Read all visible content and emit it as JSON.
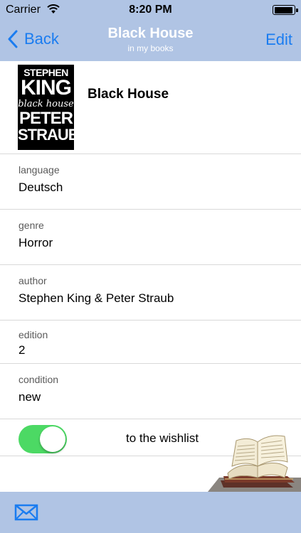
{
  "status_bar": {
    "carrier": "Carrier",
    "time": "8:20 PM",
    "battery_level": 0.95
  },
  "nav": {
    "back_label": "Back",
    "title": "Black House",
    "subtitle": "in my books",
    "edit_label": "Edit"
  },
  "book": {
    "title": "Black House",
    "cover": {
      "line1": "STEPHEN",
      "line2": "KING",
      "line3": "black house",
      "line4": "PETER",
      "line5": "STRAUB"
    }
  },
  "fields": {
    "language": {
      "label": "language",
      "value": "Deutsch"
    },
    "genre": {
      "label": "genre",
      "value": "Horror"
    },
    "author": {
      "label": "author",
      "value": "Stephen King & Peter Straub"
    },
    "edition": {
      "label": "edition",
      "value": "2"
    },
    "condition": {
      "label": "condition",
      "value": "new"
    }
  },
  "wishlist": {
    "label": "to the wishlist",
    "toggle_on": true
  },
  "icons": {
    "wifi": "wifi-icon",
    "battery": "battery-icon",
    "back": "chevron-left-icon",
    "mail": "mail-icon",
    "illustration": "open-book-illustration"
  },
  "colors": {
    "bar_background": "#b0c4e4",
    "accent": "#1a7cf0",
    "toggle_on": "#4cd964"
  }
}
